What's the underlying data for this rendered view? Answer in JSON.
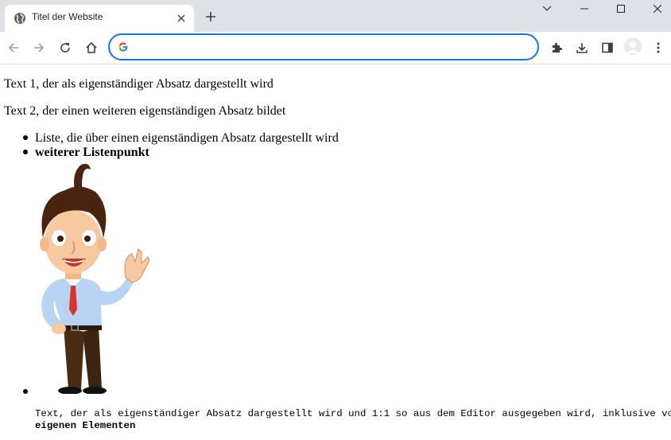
{
  "browser": {
    "tab_title": "Titel der Website",
    "icons": {
      "tab": "globe-icon",
      "close": "close-icon",
      "new_tab": "plus-icon",
      "back": "arrow-left-icon",
      "forward": "arrow-right-icon",
      "reload": "reload-icon",
      "home": "home-icon",
      "extensions": "puzzle-icon",
      "download": "download-icon",
      "side_panel": "side-panel-icon",
      "menu": "kebab-menu-icon"
    },
    "address_value": "",
    "accent_color": "#1a73e8"
  },
  "page": {
    "paragraph_1": "Text 1, der als eigenständiger Absatz dargestellt wird",
    "paragraph_2": "Text 2, der einen weiteren eigenständigen Absatz bildet",
    "list": {
      "item_1": "Liste, die über einen eigenständigen Absatz dargestellt wird",
      "item_2": "weiterer Listenpunkt",
      "item_3_image": "cartoon-man-waving"
    },
    "preformatted_line_1": "Text, der als eigenständiger Absatz dargestellt wird und 1:1 so aus dem Editor ausgegeben wird, inklusive von",
    "preformatted_line_2": "eigenen Elementen"
  }
}
